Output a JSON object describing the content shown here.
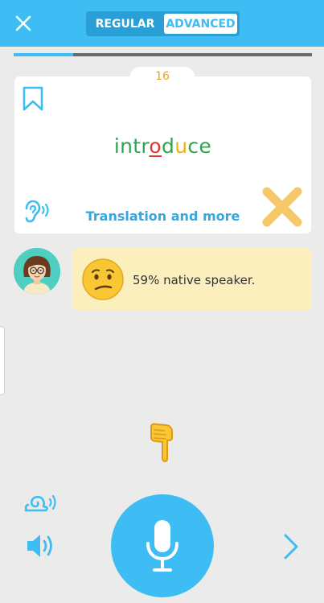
{
  "header": {
    "modes": [
      "REGULAR",
      "ADVANCED"
    ],
    "active_mode": "ADVANCED",
    "progress": 0.2
  },
  "card": {
    "count": "16",
    "word": {
      "parts": [
        {
          "text": "intr",
          "color": "#2ea44f",
          "underline": false
        },
        {
          "text": "o",
          "color": "#e03a2f",
          "underline": true
        },
        {
          "text": "d",
          "color": "#2ea44f",
          "underline": false
        },
        {
          "text": "u",
          "color": "#f0b400",
          "underline": false
        },
        {
          "text": "ce",
          "color": "#2ea44f",
          "underline": false
        }
      ]
    },
    "translation_link": "Translation and more"
  },
  "feedback": {
    "text": "59% native speaker."
  },
  "colors": {
    "accent": "#3dbdf4",
    "feedback_bg": "#fcefbe",
    "count": "#f0a020",
    "x_mark": "#f5c86a"
  }
}
